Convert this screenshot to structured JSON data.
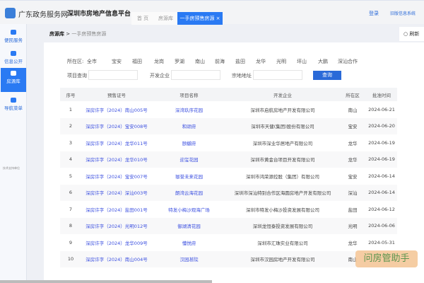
{
  "header": {
    "site_name": "广东政务服务网",
    "platform": "深圳市房地产信息平台",
    "tabs": [
      {
        "label": "首 页"
      },
      {
        "label": "房源库"
      },
      {
        "label": "一手房预售房源 ×"
      }
    ],
    "login": "登录",
    "old_system": "旧版信息系统"
  },
  "sidebar": {
    "items": [
      {
        "label": "便民服务",
        "icon": "heart-icon"
      },
      {
        "label": "信息公开",
        "icon": "mail-icon"
      },
      {
        "label": "房源库",
        "icon": "building-icon"
      },
      {
        "label": "导航菜单",
        "icon": "share-icon"
      }
    ],
    "footer": "技术支持单位"
  },
  "breadcrumb": {
    "root": "房源库",
    "current": "一手房预售房源"
  },
  "refresh": "刷新",
  "filters": {
    "district_label": "所在区:",
    "districts": [
      "全市",
      "宝安",
      "福田",
      "龙岗",
      "罗湖",
      "南山",
      "前海",
      "盐田",
      "龙华",
      "光明",
      "坪山",
      "大鹏",
      "深汕合作"
    ],
    "selected": "全市",
    "project_label": "项目查询",
    "developer_label": "开发企业",
    "address_label": "宗地地址",
    "query_button": "查询"
  },
  "table": {
    "columns": [
      "序号",
      "预售证号",
      "项目名称",
      "开发企业",
      "所在区",
      "批准时间"
    ],
    "rows": [
      [
        "1",
        "深房许字（2024）南山005号",
        "深湾玖序花园",
        "深圳市启航房地产开发有限公司",
        "南山",
        "2024-06-21"
      ],
      [
        "2",
        "深房许字（2024）宝安008号",
        "和颂府",
        "深圳市天健(集团)股份有限公司",
        "宝安",
        "2024-06-20"
      ],
      [
        "3",
        "深房许字（2024）龙华011号",
        "颐樾府",
        "深圳市深业华居地产有限公司",
        "龙华",
        "2024-06-19"
      ],
      [
        "4",
        "深房许字（2024）龙华010号",
        "迎玺花园",
        "深圳市黄金台项目开发有限公司",
        "龙华",
        "2024-06-19"
      ],
      [
        "5",
        "深房许字（2024）宝安007号",
        "珈誉未来花园",
        "深圳市鸿荣源控股（集团）有限公司",
        "宝安",
        "2024-06-14"
      ],
      [
        "6",
        "深房许字（2024）深汕003号",
        "朗湾云海花园",
        "深圳市深汕特别合作区海圆房地产开发有限公司",
        "深汕",
        "2024-06-14"
      ],
      [
        "7",
        "深房许字（2024）盐田001号",
        "特发小梅沙观海广场",
        "深圳市特发小梅沙投资发展有限公司",
        "盐田",
        "2024-06-12"
      ],
      [
        "8",
        "深房许字（2024）光明012号",
        "御湖清花园",
        "深圳龙恒泰投资发展有限公司",
        "光明",
        "2024-06-06"
      ],
      [
        "9",
        "深房许字（2024）龙华009号",
        "懂悦府",
        "深圳市汇珠实业有限公司",
        "龙华",
        "2024-05-31"
      ],
      [
        "10",
        "深房许字（2024）南山004号",
        "汉园甚院",
        "深圳市汉园房地产开发有限公司",
        "南山",
        ""
      ]
    ]
  },
  "watermark": "问房管助手",
  "colors": {
    "accent": "#2a7af3",
    "link": "#3b4fe0",
    "selected_filter": "#ff3333"
  }
}
